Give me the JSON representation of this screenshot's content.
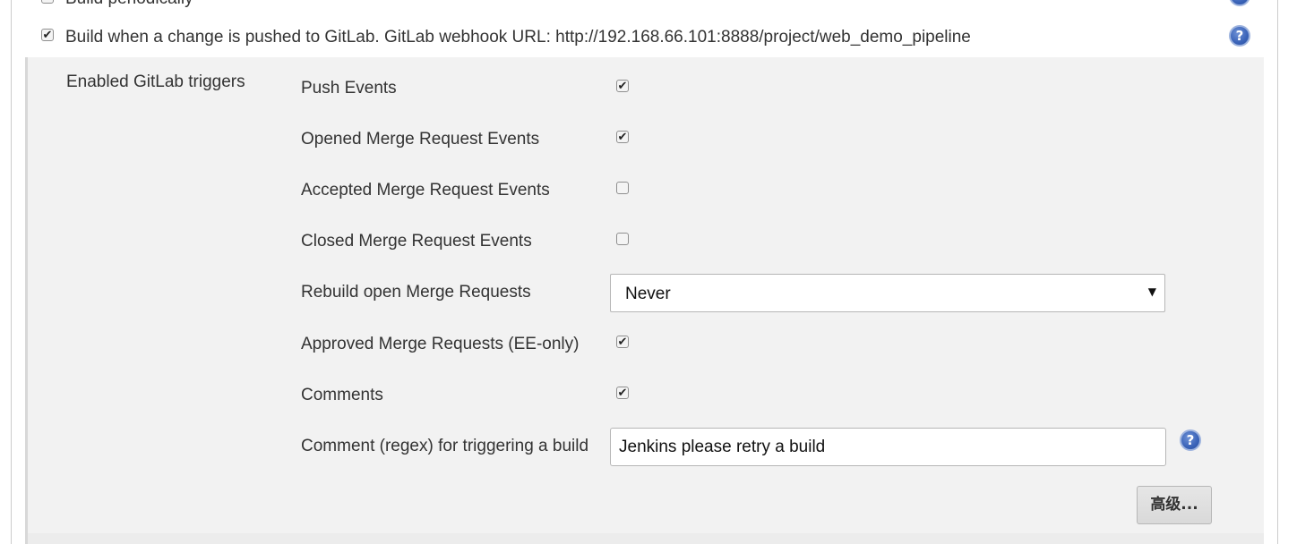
{
  "triggers_above": {
    "build_periodically_label": "Build periodically",
    "build_periodically_checked": false
  },
  "gitlab_trigger": {
    "checked": true,
    "label": "Build when a change is pushed to GitLab. GitLab webhook URL: http://192.168.66.101:8888/project/web_demo_pipeline",
    "section_label": "Enabled GitLab triggers"
  },
  "options": [
    {
      "label": "Push Events",
      "checked": true
    },
    {
      "label": "Opened Merge Request Events",
      "checked": true
    },
    {
      "label": "Accepted Merge Request Events",
      "checked": false
    },
    {
      "label": "Closed Merge Request Events",
      "checked": false
    }
  ],
  "rebuild": {
    "label": "Rebuild open Merge Requests",
    "value": "Never"
  },
  "options2": [
    {
      "label": "Approved Merge Requests (EE-only)",
      "checked": true
    },
    {
      "label": "Comments",
      "checked": true
    }
  ],
  "comment_regex": {
    "label": "Comment (regex) for triggering a build",
    "value": "Jenkins please retry a build"
  },
  "advanced_button": "高级...",
  "icons": {
    "help": "help-icon",
    "checkbox_tick": "✔",
    "dropdown": "▼",
    "help_glyph": "?"
  }
}
